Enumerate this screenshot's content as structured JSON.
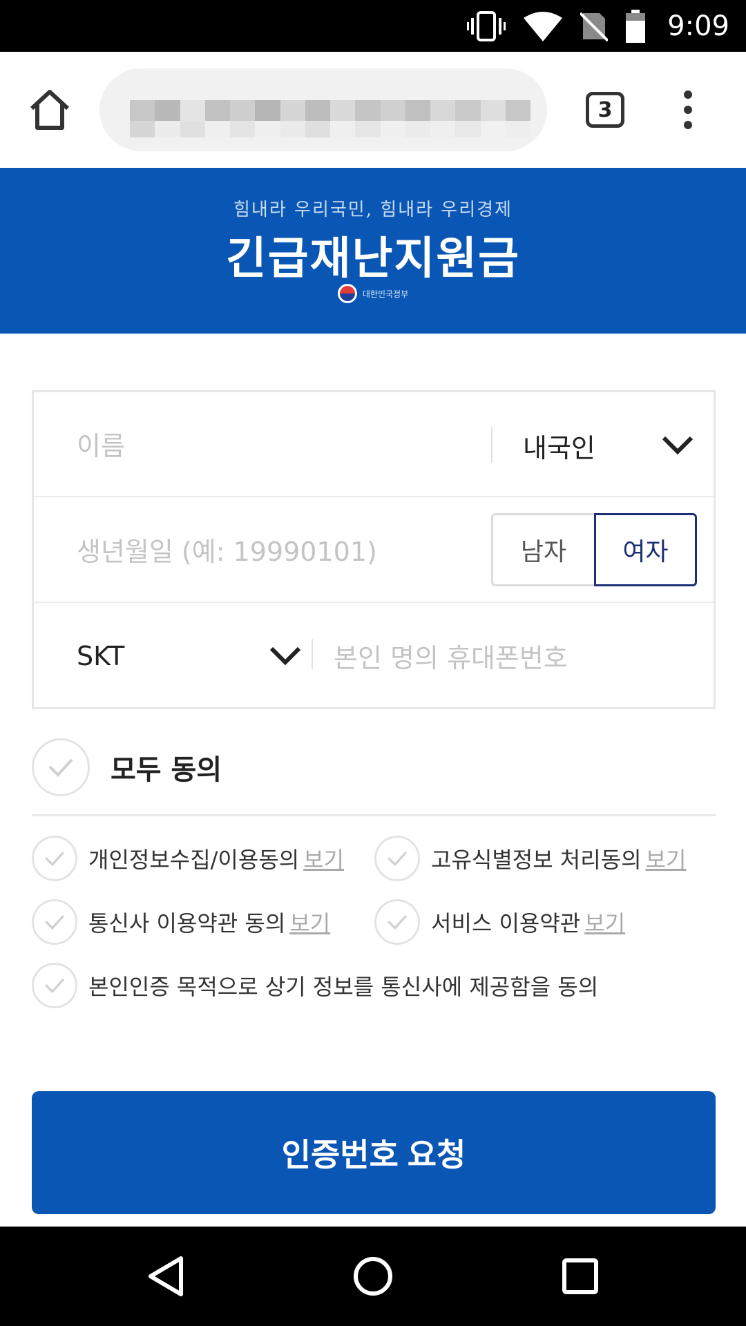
{
  "status_bar": {
    "time": "9:09",
    "icons": [
      "vibrate-icon",
      "wifi-icon",
      "no-sim-icon",
      "battery-icon"
    ]
  },
  "browser": {
    "tab_count": "3",
    "icons": [
      "home-icon",
      "overflow-menu-icon"
    ]
  },
  "banner": {
    "subtitle": "힘내라 우리국민, 힘내라 우리경제",
    "title": "긴급재난지원금",
    "gov_label": "대한민국정부",
    "background": "#0a56b4"
  },
  "form": {
    "name_placeholder": "이름",
    "nationality": "내국인",
    "birth_placeholder": "생년월일 (예: 19990101)",
    "gender_male": "남자",
    "gender_female": "여자",
    "gender_selected": "여자",
    "carrier": "SKT",
    "phone_placeholder": "본인 명의 휴대폰번호"
  },
  "agreements": {
    "all_label": "모두 동의",
    "view_label": "보기",
    "items": [
      {
        "label": "개인정보수집/이용동의"
      },
      {
        "label": "고유식별정보 처리동의"
      },
      {
        "label": "통신사 이용약관 동의"
      },
      {
        "label": "서비스 이용약관"
      },
      {
        "label": "본인인증 목적으로 상기 정보를 통신사에 제공함을 동의"
      }
    ]
  },
  "request_button": "인증번호 요청",
  "nav": {
    "icons": [
      "back-icon",
      "home-nav-icon",
      "recents-icon"
    ]
  },
  "accent_color": "#0a56b4",
  "selected_color": "#1c2f73"
}
